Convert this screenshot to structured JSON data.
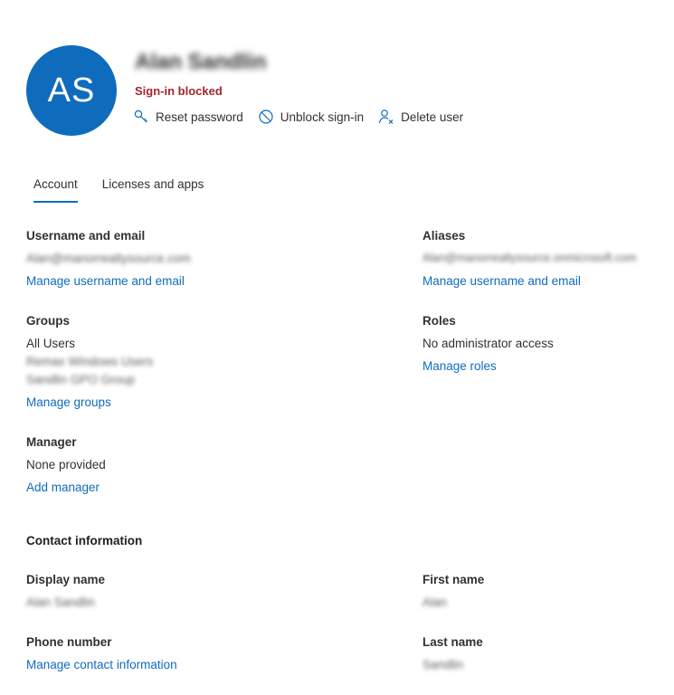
{
  "user": {
    "initials": "AS",
    "display_name": "Alan Sandlin",
    "status": "Sign-in blocked"
  },
  "actions": {
    "reset_password": "Reset password",
    "unblock_signin": "Unblock sign-in",
    "delete_user": "Delete user"
  },
  "tabs": [
    {
      "label": "Account",
      "active": true
    },
    {
      "label": "Licenses and apps",
      "active": false
    }
  ],
  "account": {
    "username_email": {
      "label": "Username and email",
      "value": "Alan@manorrealtysource.com",
      "link": "Manage username and email"
    },
    "aliases": {
      "label": "Aliases",
      "value": "Alan@manorrealtysource.onmicrosoft.com",
      "link": "Manage username and email"
    },
    "groups": {
      "label": "Groups",
      "values": [
        "All Users",
        "Remax Windows Users",
        "Sandlin GPO Group"
      ],
      "link": "Manage groups"
    },
    "roles": {
      "label": "Roles",
      "value": "No administrator access",
      "link": "Manage roles"
    },
    "manager": {
      "label": "Manager",
      "value": "None provided",
      "link": "Add manager"
    }
  },
  "contact": {
    "title": "Contact information",
    "display_name": {
      "label": "Display name",
      "value": "Alan Sandlin"
    },
    "first_name": {
      "label": "First name",
      "value": "Alan"
    },
    "phone_number": {
      "label": "Phone number",
      "link": "Manage contact information"
    },
    "last_name": {
      "label": "Last name",
      "value": "Sandlin"
    }
  },
  "colors": {
    "accent": "#0f6cbd",
    "status_red": "#a4262c",
    "text": "#323130"
  },
  "icons": {
    "reset_password": "key-icon",
    "unblock_signin": "block-icon",
    "delete_user": "person-delete-icon"
  }
}
